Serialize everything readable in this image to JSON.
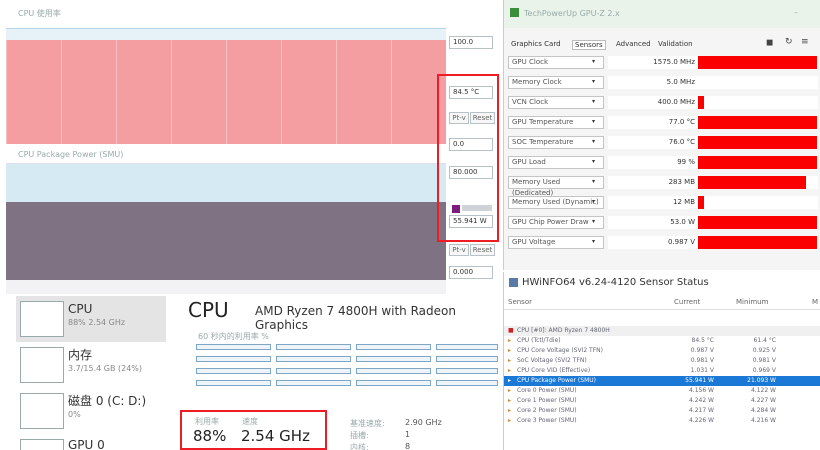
{
  "left_window": {
    "title": "CPU 使用率",
    "band_label": "CPU Package Power (SMU)",
    "fields": {
      "top_value": "100.0",
      "temp": "84.5 °C",
      "btn_a": "Pt-v",
      "btn_a2": "Reset",
      "min_value": "0.0",
      "field_80": "80.000",
      "power_value": "55.941 W",
      "btn_b": "Pt-v",
      "btn_b2": "Reset",
      "bottom_value": "0.000"
    },
    "colors": {
      "pink": "#f49ea2",
      "slate": "#7e7283",
      "highlight": "#ee1c24"
    }
  },
  "perf": {
    "items": [
      {
        "title": "CPU",
        "sub": "88% 2.54 GHz"
      },
      {
        "title": "内存",
        "sub": "3.7/15.4 GB (24%)"
      },
      {
        "title": "磁盘 0 (C: D:)",
        "sub": "0%"
      },
      {
        "title": "GPU 0",
        "sub": ""
      }
    ],
    "main_title": "CPU",
    "model": "AMD Ryzen 7 4800H with Radeon Graphics",
    "sub_caption": "60 秒内的利用率 %",
    "stats": {
      "util_label": "利用率",
      "speed_label": "速度",
      "util": "88%",
      "speed": "2.54 GHz",
      "base_label": "基准速度:",
      "base_value": "2.90 GHz",
      "sockets_label": "插槽:",
      "sockets_value": "1",
      "cores_label": "内核:",
      "cores_value": "8"
    }
  },
  "gpuz": {
    "title": "TechPowerUp GPU-Z 2.x",
    "tabs": [
      "Graphics Card",
      "Sensors",
      "Advanced",
      "Validation"
    ],
    "rows": [
      {
        "label": "GPU Clock",
        "value": "1575.0 MHz",
        "bar": 0.99
      },
      {
        "label": "Memory Clock",
        "value": "5.0 MHz",
        "bar": 0.0
      },
      {
        "label": "VCN Clock",
        "value": "400.0 MHz",
        "bar": 0.05
      },
      {
        "label": "GPU Temperature",
        "value": "77.0 °C",
        "bar": 0.99
      },
      {
        "label": "SOC Temperature",
        "value": "76.0 °C",
        "bar": 0.99
      },
      {
        "label": "GPU Load",
        "value": "99 %",
        "bar": 0.99
      },
      {
        "label": "Memory Used (Dedicated)",
        "value": "283 MB",
        "bar": 0.9
      },
      {
        "label": "Memory Used (Dynamic)",
        "value": "12 MB",
        "bar": 0.05
      },
      {
        "label": "GPU Chip Power Draw",
        "value": "53.0 W",
        "bar": 0.99
      },
      {
        "label": "GPU Voltage",
        "value": "0.987 V",
        "bar": 0.99
      }
    ]
  },
  "hwinfo": {
    "title": "HWiNFO64 v6.24-4120 Sensor Status",
    "columns": [
      "Sensor",
      "Current",
      "Minimum",
      "M"
    ],
    "group": "CPU [#0]: AMD Ryzen 7 4800H",
    "rows": [
      {
        "name": "CPU (Tctl/Tdie)",
        "current": "84.5 °C",
        "min": "61.4 °C",
        "sel": false
      },
      {
        "name": "CPU Core Voltage (SVI2 TFN)",
        "current": "0.987 V",
        "min": "0.925 V",
        "sel": false
      },
      {
        "name": "SoC Voltage (SVI2 TFN)",
        "current": "0.981 V",
        "min": "0.981 V",
        "sel": false
      },
      {
        "name": "CPU Core VID (Effective)",
        "current": "1.031 V",
        "min": "0.969 V",
        "sel": false
      },
      {
        "name": "CPU Package Power (SMU)",
        "current": "55.941 W",
        "min": "21.093 W",
        "sel": true
      },
      {
        "name": "Core 0 Power (SMU)",
        "current": "4.156 W",
        "min": "4.122 W",
        "sel": false
      },
      {
        "name": "Core 1 Power (SMU)",
        "current": "4.242 W",
        "min": "4.227 W",
        "sel": false
      },
      {
        "name": "Core 2 Power (SMU)",
        "current": "4.217 W",
        "min": "4.284 W",
        "sel": false
      },
      {
        "name": "Core 3 Power (SMU)",
        "current": "4.226 W",
        "min": "4.216 W",
        "sel": false
      }
    ]
  }
}
